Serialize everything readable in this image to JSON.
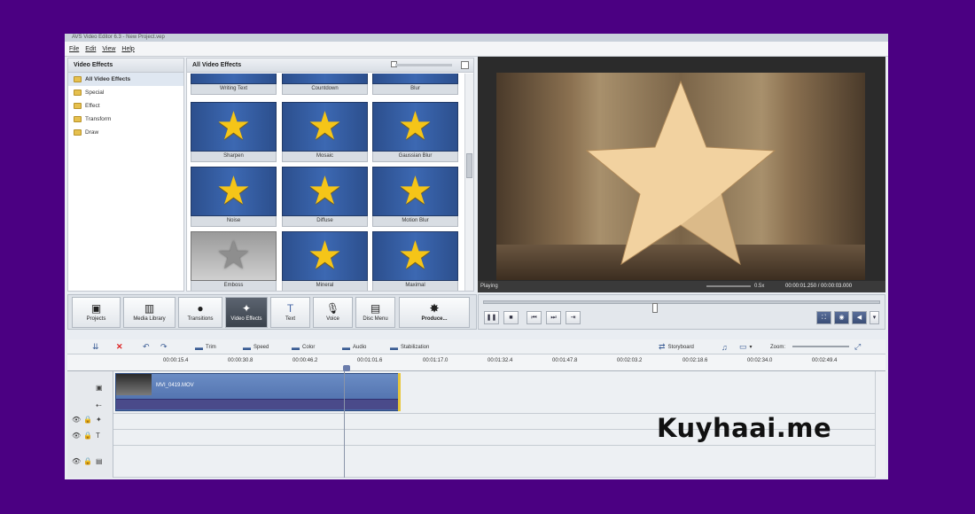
{
  "app": {
    "title": "AVS Video Editor 6.3 - New Project.vep",
    "menu": [
      "File",
      "Edit",
      "View",
      "Help"
    ]
  },
  "effects_tree": {
    "header": "Video Effects",
    "items": [
      "All Video Effects",
      "Special",
      "Effect",
      "Transform",
      "Draw"
    ]
  },
  "effects_grid": {
    "header": "All Video Effects",
    "tiles": [
      "Writing Text",
      "Countdown",
      "Blur",
      "Sharpen",
      "Mosaic",
      "Gaussian Blur",
      "Noise",
      "Diffuse",
      "Motion Blur",
      "Emboss",
      "Mineral",
      "Maximal"
    ]
  },
  "preview": {
    "status": "Playing",
    "speed": "0.5x",
    "time": "00:00:01.250 / 00:00:03.000"
  },
  "bigbar": {
    "buttons": [
      "Projects",
      "Media Library",
      "Transitions",
      "Video Effects",
      "Text",
      "Voice",
      "Disc Menu",
      "Produce..."
    ],
    "active": "Video Effects"
  },
  "timeline_tools": {
    "trim": "Trim",
    "speed": "Speed",
    "color": "Color",
    "audio": "Audio",
    "stabilization": "Stabilization",
    "storyboard": "Storyboard",
    "zoom": "Zoom:"
  },
  "ruler": [
    "00:00:15.4",
    "00:00:30.8",
    "00:00:46.2",
    "00:01:01.6",
    "00:01:17.0",
    "00:01:32.4",
    "00:01:47.8",
    "00:02:03.2",
    "00:02:18.6",
    "00:02:34.0",
    "00:02:49.4"
  ],
  "clip": {
    "name": "MVI_0419.MOV"
  },
  "watermark": "Kuyhaai.me"
}
